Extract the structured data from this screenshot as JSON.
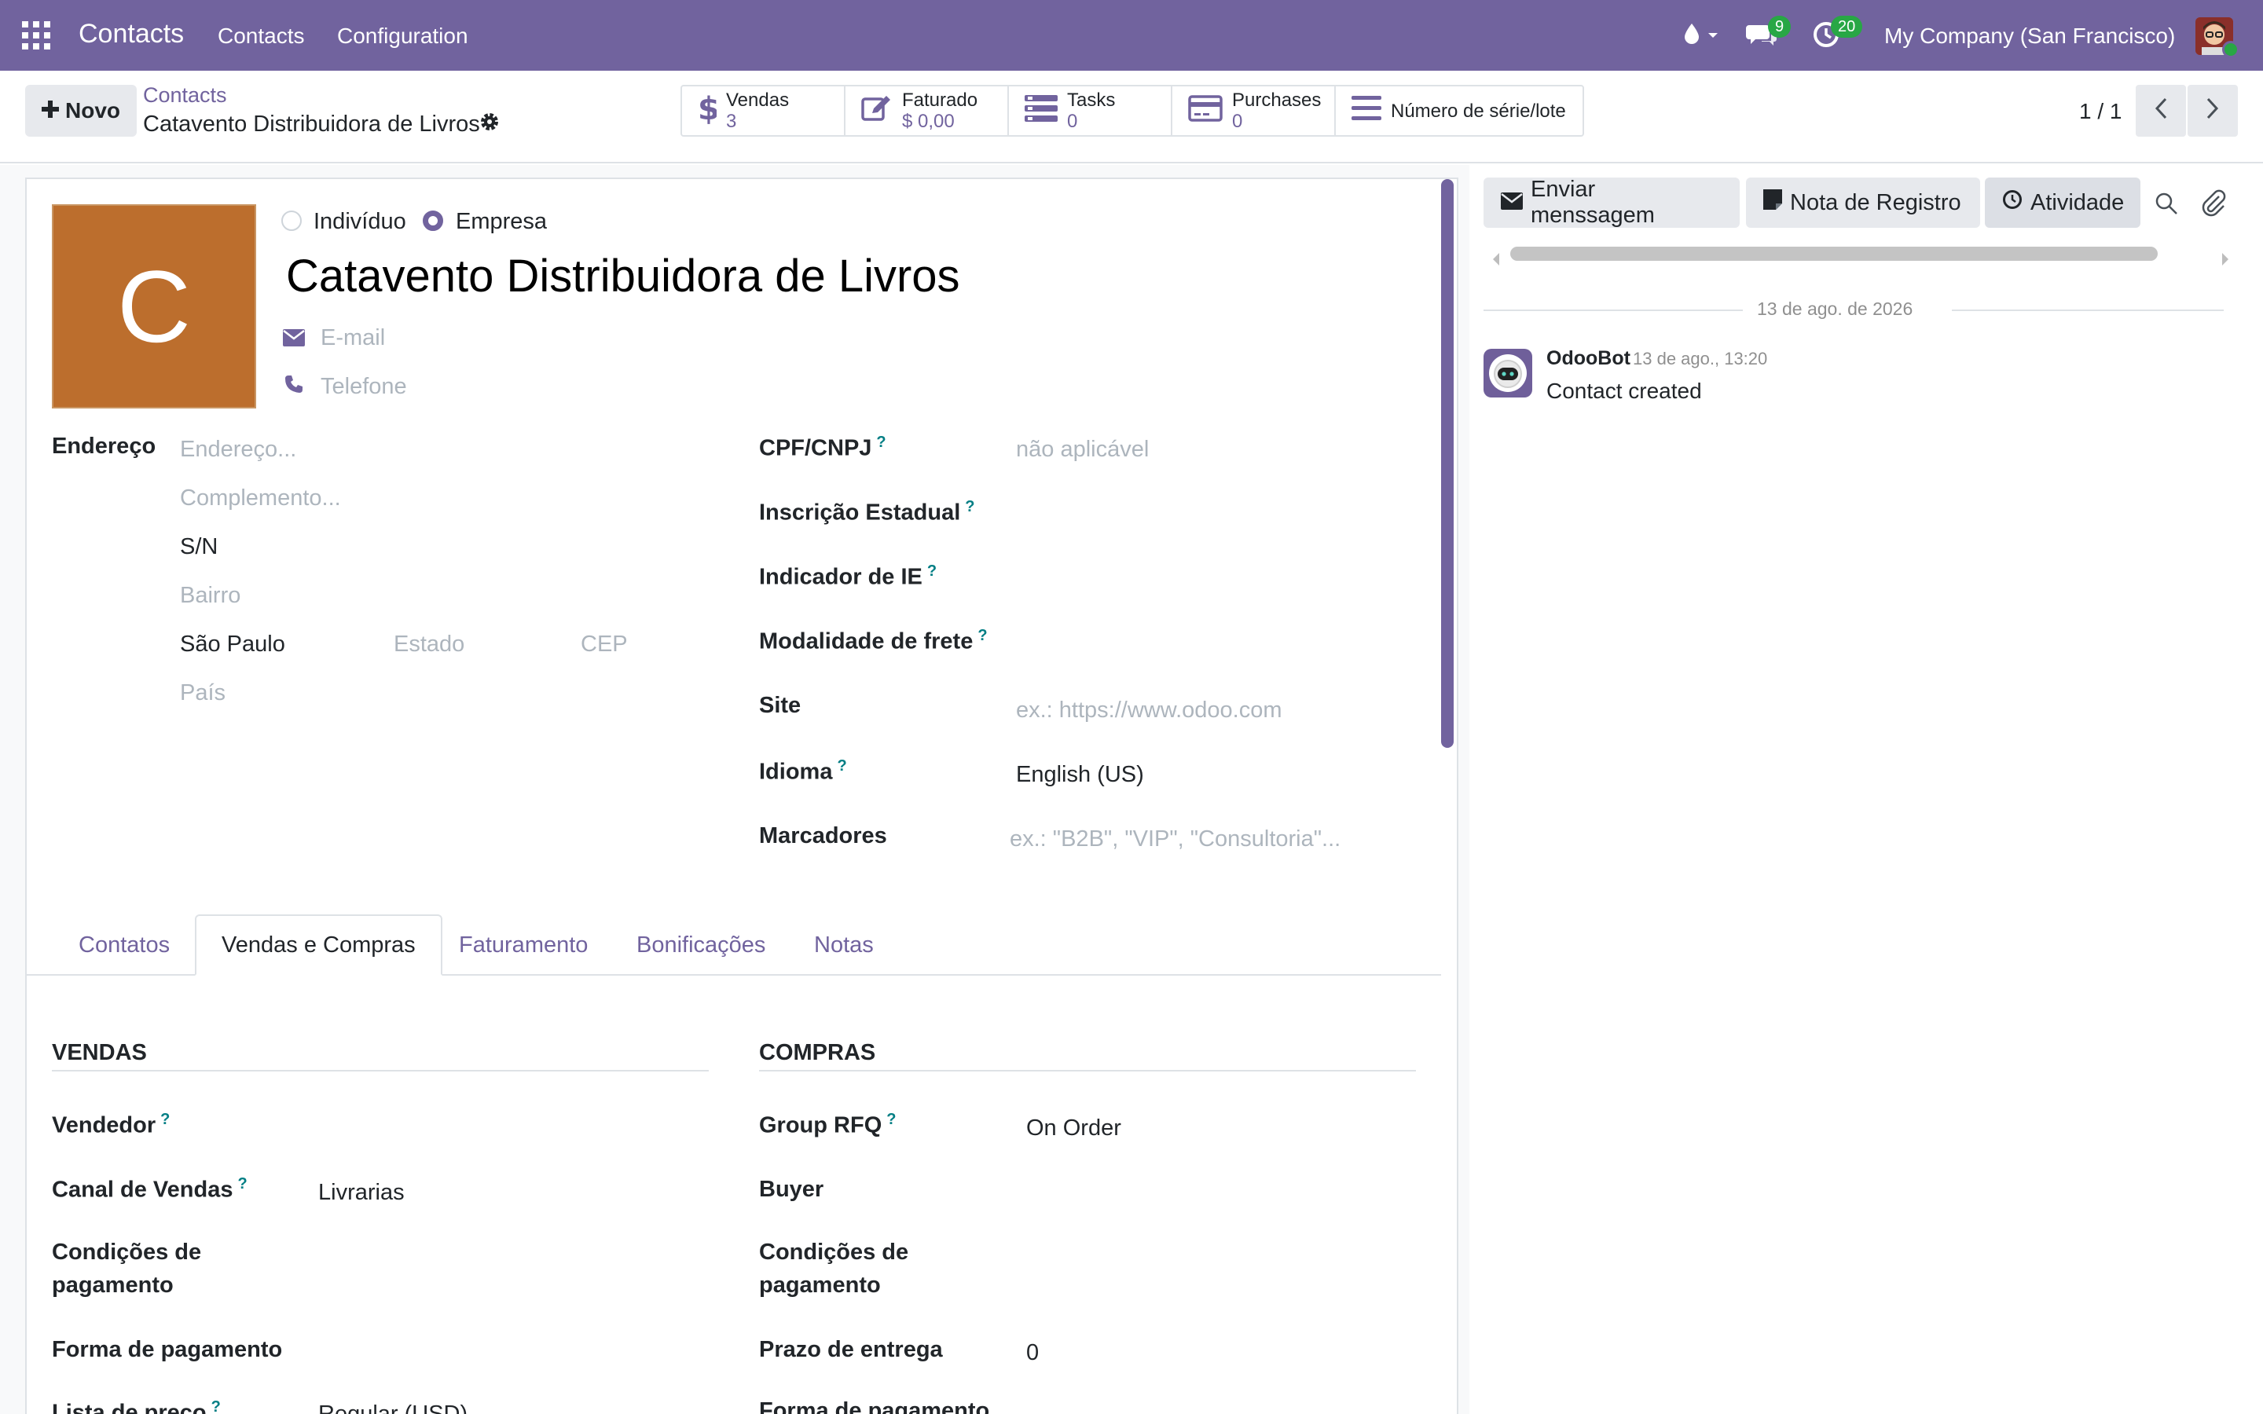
{
  "navbar": {
    "app_title": "Contacts",
    "menu": [
      "Contacts",
      "Configuration"
    ],
    "messages_count": "9",
    "activities_count": "20",
    "company": "My Company (San Francisco)"
  },
  "control": {
    "new_label": "Novo",
    "breadcrumb_parent": "Contacts",
    "breadcrumb_current": "Catavento Distribuidora de Livros",
    "smart_buttons": [
      {
        "label": "Vendas",
        "value": "3",
        "icon": "dollar-icon"
      },
      {
        "label": "Faturado",
        "value": "$ 0,00",
        "icon": "invoice-edit-icon"
      },
      {
        "label": "Tasks",
        "value": "0",
        "icon": "tasks-icon"
      },
      {
        "label": "Purchases",
        "value": "0",
        "icon": "credit-card-icon"
      },
      {
        "label": "Número de série/lote",
        "value": "",
        "icon": "bars-icon"
      }
    ],
    "pager": "1 / 1"
  },
  "form": {
    "avatar_letter": "C",
    "type_individual": "Indivíduo",
    "type_company": "Empresa",
    "selected_type": "Empresa",
    "name": "Catavento Distribuidora de Livros",
    "email_placeholder": "E-mail",
    "phone_placeholder": "Telefone",
    "address_label": "Endereço",
    "street_placeholder": "Endereço...",
    "street2_placeholder": "Complemento...",
    "number": "S/N",
    "district_placeholder": "Bairro",
    "city": "São Paulo",
    "state_placeholder": "Estado",
    "zip_placeholder": "CEP",
    "country_placeholder": "País",
    "cpf_label": "CPF/CNPJ",
    "cpf_placeholder": "não aplicável",
    "ie_label": "Inscrição Estadual",
    "ie_indicator_label": "Indicador de IE",
    "freight_label": "Modalidade de frete",
    "site_label": "Site",
    "site_placeholder": "ex.: https://www.odoo.com",
    "lang_label": "Idioma",
    "lang_value": "English (US)",
    "tags_label": "Marcadores",
    "tags_placeholder": "ex.: \"B2B\", \"VIP\", \"Consultoria\"...",
    "tooltip_mark": "?"
  },
  "tabs": [
    "Contatos",
    "Vendas e Compras",
    "Faturamento",
    "Bonificações",
    "Notas"
  ],
  "active_tab": "Vendas e Compras",
  "sales": {
    "title": "VENDAS",
    "salesperson_label": "Vendedor",
    "channel_label": "Canal de Vendas",
    "channel_value": "Livrarias",
    "payment_terms_label_1": "Condições de",
    "payment_terms_label_2": "pagamento",
    "payment_method_label": "Forma de pagamento",
    "pricelist_label": "Lista de preço",
    "pricelist_value": "Regular (USD)"
  },
  "purchases": {
    "title": "COMPRAS",
    "group_rfq_label": "Group RFQ",
    "group_rfq_value": "On Order",
    "buyer_label": "Buyer",
    "payment_terms_label_1": "Condições de",
    "payment_terms_label_2": "pagamento",
    "lead_time_label": "Prazo de entrega",
    "lead_time_value": "0",
    "payment_method_label": "Forma de pagamento"
  },
  "chatter": {
    "send_message": "Enviar menssagem",
    "log_note": "Nota de Registro",
    "activity": "Atividade",
    "date_separator": "13 de ago. de 2026",
    "message_author": "OdooBot",
    "message_time": "13 de ago., 13:20",
    "message_body": "Contact created"
  },
  "colors": {
    "brand": "#71639e",
    "avatar_bg": "#bc6e2d",
    "badge": "#28a745",
    "tooltip": "#017e84"
  }
}
